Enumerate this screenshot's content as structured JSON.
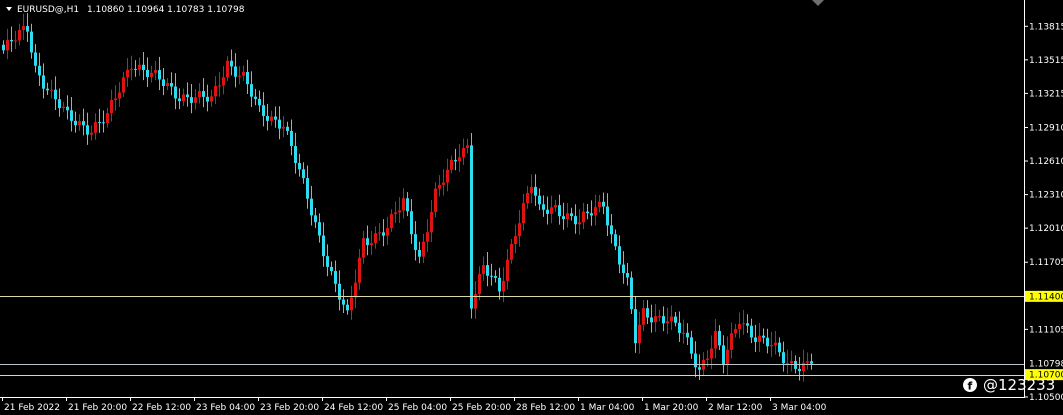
{
  "header": {
    "symbol": "EURUSD@,H1",
    "quotes": "1.10860 1.10964 1.10783 1.10798"
  },
  "colors": {
    "background": "#000000",
    "bull": "#e01313",
    "bear": "#2cdcf0",
    "frame": "#ffffff",
    "level_line": "#d8d8a8",
    "level_label_bg": "#ffff00",
    "price_line": "#b8c4c8"
  },
  "watermark": {
    "icon": "facebook-icon",
    "text": "@123233"
  },
  "chart_data": {
    "type": "candlestick",
    "symbol": "EURUSD",
    "timeframe": "H1",
    "ylim": [
      1.105,
      1.1405
    ],
    "y_ticks": [
      "1.13815",
      "1.13515",
      "1.13215",
      "1.12910",
      "1.12610",
      "1.12310",
      "1.12010",
      "1.11705",
      "1.11105",
      "1.10500"
    ],
    "x_ticks": [
      {
        "label": "21 Feb 2022",
        "index": 0
      },
      {
        "label": "21 Feb 20:00",
        "index": 16
      },
      {
        "label": "22 Feb 12:00",
        "index": 32
      },
      {
        "label": "23 Feb 04:00",
        "index": 48
      },
      {
        "label": "23 Feb 20:00",
        "index": 64
      },
      {
        "label": "24 Feb 12:00",
        "index": 80
      },
      {
        "label": "25 Feb 04:00",
        "index": 96
      },
      {
        "label": "25 Feb 20:00",
        "index": 112
      },
      {
        "label": "28 Feb 12:00",
        "index": 128
      },
      {
        "label": "1 Mar 04:00",
        "index": 144
      },
      {
        "label": "1 Mar 20:00",
        "index": 160
      },
      {
        "label": "2 Mar 12:00",
        "index": 176
      },
      {
        "label": "3 Mar 04:00",
        "index": 192
      }
    ],
    "horizontal_lines": [
      {
        "value": 1.114,
        "label": "1.11400"
      },
      {
        "value": 1.107,
        "label": "1.10700"
      }
    ],
    "current_price": {
      "value": 1.10798,
      "label": "1.10798"
    },
    "close_path": [
      [
        0,
        1.136
      ],
      [
        6,
        1.138
      ],
      [
        8,
        1.1345
      ],
      [
        12,
        1.132
      ],
      [
        16,
        1.13
      ],
      [
        22,
        1.129
      ],
      [
        26,
        1.13
      ],
      [
        32,
        1.135
      ],
      [
        38,
        1.1335
      ],
      [
        44,
        1.132
      ],
      [
        52,
        1.1315
      ],
      [
        56,
        1.135
      ],
      [
        60,
        1.1335
      ],
      [
        64,
        1.1305
      ],
      [
        70,
        1.1295
      ],
      [
        74,
        1.125
      ],
      [
        78,
        1.1205
      ],
      [
        82,
        1.116
      ],
      [
        86,
        1.112
      ],
      [
        90,
        1.119
      ],
      [
        96,
        1.12
      ],
      [
        100,
        1.1225
      ],
      [
        104,
        1.1175
      ],
      [
        108,
        1.123
      ],
      [
        114,
        1.127
      ],
      [
        116,
        1.1275
      ],
      [
        117,
        1.1135
      ],
      [
        120,
        1.1165
      ],
      [
        124,
        1.1145
      ],
      [
        128,
        1.12
      ],
      [
        132,
        1.124
      ],
      [
        134,
        1.1215
      ],
      [
        138,
        1.122
      ],
      [
        144,
        1.1205
      ],
      [
        150,
        1.1225
      ],
      [
        152,
        1.1195
      ],
      [
        156,
        1.115
      ],
      [
        158,
        1.11
      ],
      [
        160,
        1.1125
      ],
      [
        166,
        1.112
      ],
      [
        170,
        1.1105
      ],
      [
        174,
        1.1075
      ],
      [
        178,
        1.1105
      ],
      [
        180,
        1.108
      ],
      [
        184,
        1.112
      ],
      [
        188,
        1.1105
      ],
      [
        192,
        1.1095
      ],
      [
        196,
        1.108
      ],
      [
        202,
        1.10798
      ]
    ]
  }
}
